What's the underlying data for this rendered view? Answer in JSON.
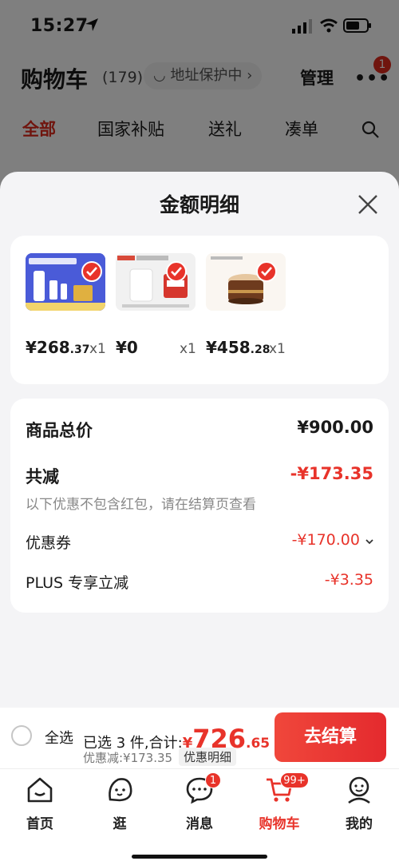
{
  "status": {
    "time": "15:27"
  },
  "cart": {
    "title": "购物车",
    "count": "(179)",
    "address": "◡ 地址保护中 ›",
    "manage": "管理",
    "more_badge": "1",
    "tabs": [
      "全部",
      "国家补贴",
      "送礼",
      "凑单"
    ]
  },
  "sheet": {
    "title": "金额明细",
    "products": [
      {
        "price_main": "¥268",
        "price_dec": ".37",
        "qty": "x1",
        "color": "#4a5bd8"
      },
      {
        "price_main": "¥0",
        "price_dec": "",
        "qty": "x1",
        "color": "#eeeeee"
      },
      {
        "price_main": "¥458",
        "price_dec": ".28",
        "qty": "x1",
        "color": "#f6f0e8"
      }
    ],
    "summary": {
      "total_label": "商品总价",
      "total_value": "¥900.00",
      "reduce_label": "共减",
      "reduce_value": "-¥173.35",
      "reduce_note": "以下优惠不包含红包，请在结算页查看",
      "coupon_label": "优惠券",
      "coupon_value": "-¥170.00",
      "plus_label": "PLUS 专享立减",
      "plus_value": "-¥3.35"
    }
  },
  "checkout": {
    "select_all": "全选",
    "selected_text": "已选 3 件,合计:",
    "total_yen": "¥",
    "total_int": "726",
    "total_dec": ".65",
    "discount_text": "优惠减:¥173.35",
    "detail_chip": "优惠明细",
    "button": "去结算"
  },
  "tabbar": {
    "items": [
      {
        "label": "首页"
      },
      {
        "label": "逛"
      },
      {
        "label": "消息",
        "badge": "1"
      },
      {
        "label": "购物车",
        "badge": "99+"
      },
      {
        "label": "我的"
      }
    ]
  },
  "colors": {
    "accent": "#e8332a"
  }
}
